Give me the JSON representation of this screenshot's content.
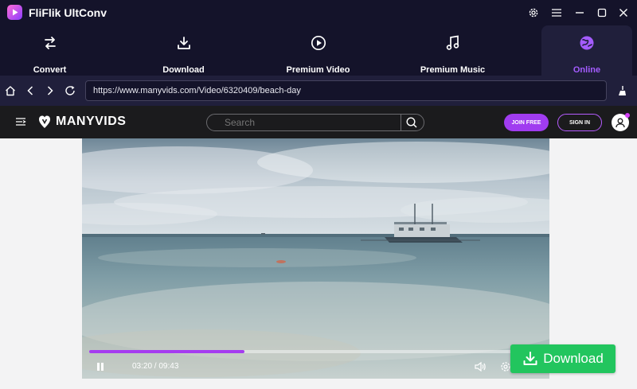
{
  "app": {
    "title": "FliFlik UltConv"
  },
  "window_controls": {
    "icons": [
      "settings-icon",
      "menu-icon",
      "minimize-icon",
      "maximize-icon",
      "close-icon"
    ]
  },
  "tabs": [
    {
      "label": "Convert",
      "icon": "convert-icon",
      "active": false
    },
    {
      "label": "Download",
      "icon": "download-icon",
      "active": false
    },
    {
      "label": "Premium Video",
      "icon": "play-circle-icon",
      "active": false
    },
    {
      "label": "Premium Music",
      "icon": "music-note-icon",
      "active": false
    },
    {
      "label": "Online",
      "icon": "globe-icon",
      "active": true
    }
  ],
  "browser": {
    "url": "https://www.manyvids.com/Video/6320409/beach-day",
    "nav_icons": [
      "home-icon",
      "back-icon",
      "forward-icon",
      "refresh-icon"
    ],
    "clean_icon": "broom-icon"
  },
  "site": {
    "logo_text": "MANYVIDS",
    "search_placeholder": "Search",
    "join_label": "JOIN FREE",
    "signin_label": "SIGN IN"
  },
  "player": {
    "time": "03:20 / 09:43",
    "progress_fraction": 0.343
  },
  "download_button": {
    "label": "Download"
  },
  "colors": {
    "app_bg": "#14132a",
    "accent_purple": "#a45cff",
    "site_purple": "#a03cf0",
    "download_green": "#22c55e"
  }
}
